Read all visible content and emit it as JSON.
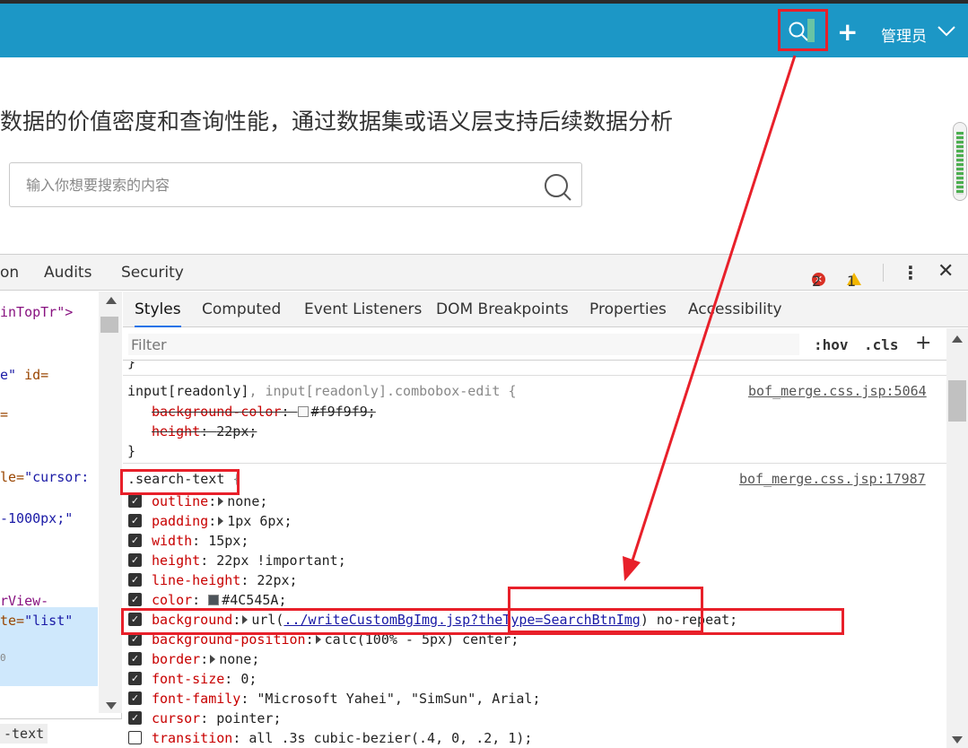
{
  "topbar": {
    "user_label": "管理员",
    "plus_label": "+",
    "color": "#1c97c6"
  },
  "page": {
    "headline": "数据的价值密度和查询性能，通过数据集或语义层支持后续数据分析",
    "search_placeholder": "输入你想要搜索的内容"
  },
  "devtools": {
    "tabs": [
      "on",
      "Audits",
      "Security"
    ],
    "error_count": "2",
    "warning_count": "1",
    "subtabs": [
      "Styles",
      "Computed",
      "Event Listeners",
      "DOM Breakpoints",
      "Properties",
      "Accessibility"
    ],
    "filter_placeholder": "Filter",
    "hov": ":hov",
    "cls": ".cls",
    "elements": {
      "line1": "inTopTr\">",
      "line2_val": "e\"",
      "line2_attr": " id=",
      "line3": "=",
      "line4_attr": "le=",
      "line4_val": "\"cursor:",
      "line5": "-1000px;\"",
      "line6": "rView-",
      "line7_attr": "te=",
      "line7_val": "\"list\"",
      "line8": "0",
      "breadcrumb": "-text"
    },
    "styles": {
      "rule1_selector_a": "input[readonly]",
      "rule1_comma": ", ",
      "rule1_selector_b": "input[readonly].combobox-edit",
      "rule1_source": "bof_merge.css.jsp:5064",
      "rule1_props": [
        {
          "name": "background-color",
          "value": "#f9f9f9",
          "swatch": "#f9f9f9"
        },
        {
          "name": "height",
          "value": "22px"
        }
      ],
      "rule2_selector": ".search-text",
      "rule2_source": "bof_merge.css.jsp:17987",
      "rule2_props": [
        {
          "name": "outline",
          "value": "none"
        },
        {
          "name": "padding",
          "value": "1px 6px"
        },
        {
          "name": "width",
          "value": "15px"
        },
        {
          "name": "height",
          "value": "22px !important"
        },
        {
          "name": "line-height",
          "value": "22px"
        },
        {
          "name": "color",
          "value": "#4C545A",
          "swatch": "#4C545A"
        },
        {
          "name": "background",
          "value_pre": "url(",
          "value_link": "../writeCustomBgImg.jsp?theType=SearchBtnImg",
          "value_post": ") no-repeat;"
        },
        {
          "name": "background-position",
          "value": "calc(100% - 5px) center"
        },
        {
          "name": "border",
          "value": "none"
        },
        {
          "name": "font-size",
          "value": "0"
        },
        {
          "name": "font-family",
          "value": "\"Microsoft Yahei\", \"SimSun\", Arial"
        },
        {
          "name": "cursor",
          "value": "pointer"
        },
        {
          "name": "transition",
          "value": "all .3s cubic-bezier(.4, 0, .2, 1)"
        }
      ]
    }
  },
  "annotation_color": "#e8202a"
}
